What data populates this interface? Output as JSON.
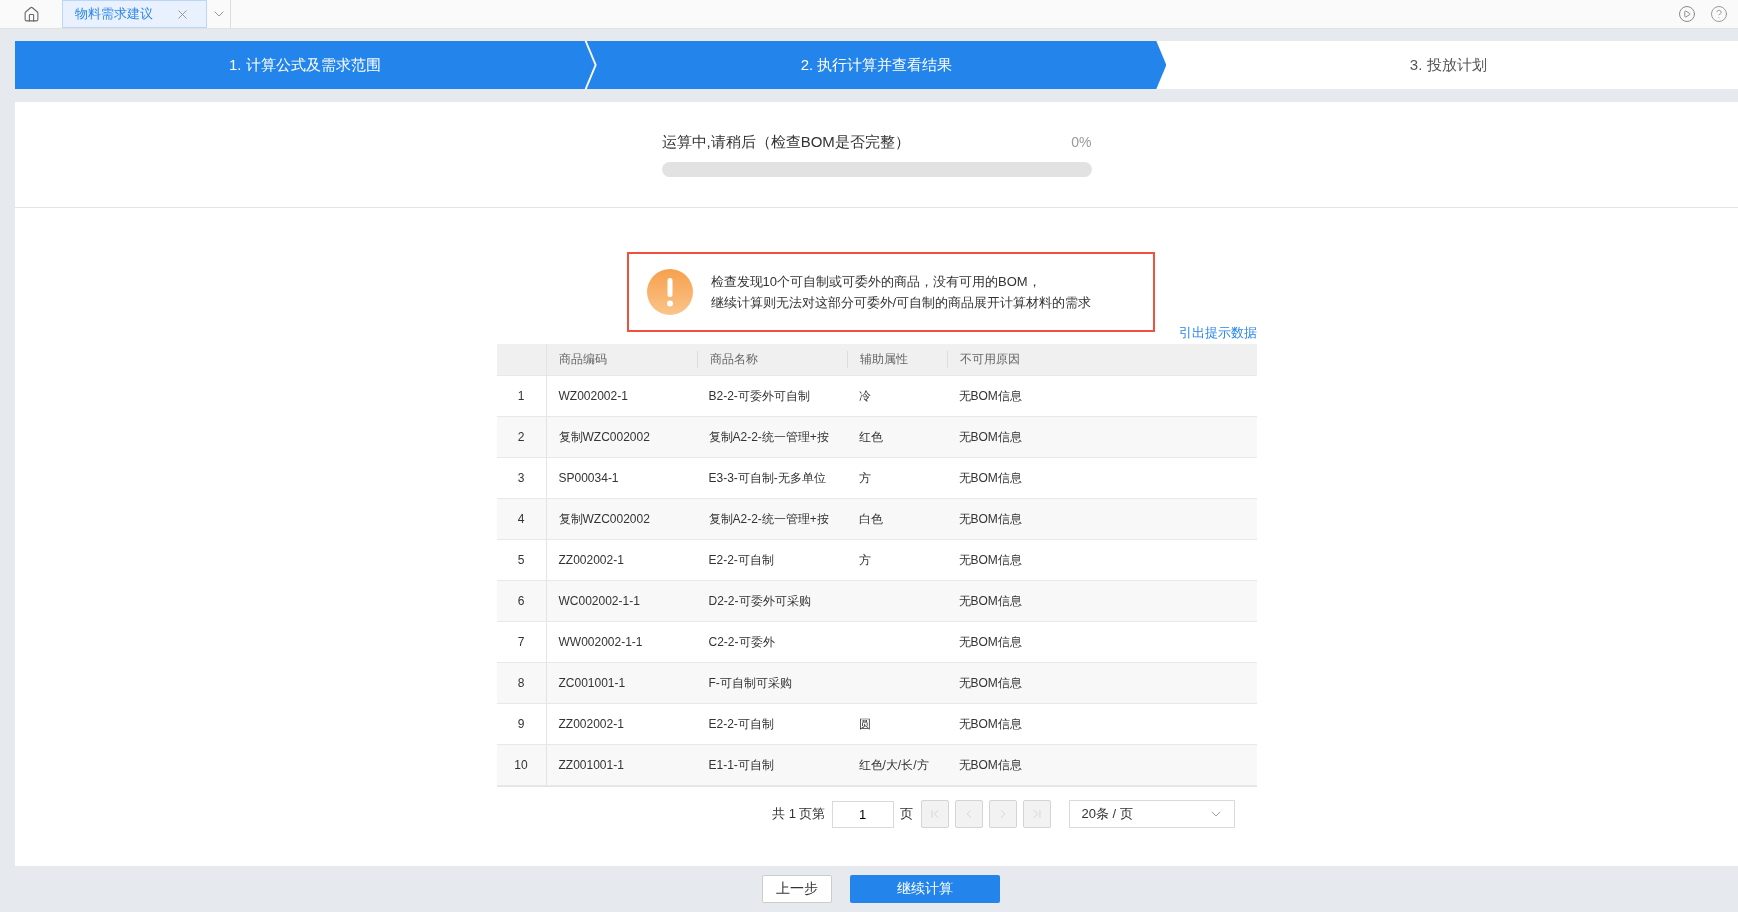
{
  "tab_bar": {
    "tab": {
      "label": "物料需求建议",
      "selected": true
    }
  },
  "steps": [
    {
      "label": "1. 计算公式及需求范围",
      "active": true
    },
    {
      "label": "2. 执行计算并查看结果",
      "active": true
    },
    {
      "label": "3. 投放计划",
      "active": false
    }
  ],
  "progress": {
    "message": "运算中,请稍后（检查BOM是否完整）",
    "percent": "0%",
    "level": 0
  },
  "warning": {
    "lines": [
      "检查发现10个可自制或可委外的商品，没有可用的BOM，",
      "继续计算则无法对这部分可委外/可自制的商品展开计算材料的需求"
    ]
  },
  "export_link": "引出提示数据",
  "table": {
    "columns": [
      "商品编码",
      "商品名称",
      "辅助属性",
      "不可用原因"
    ],
    "rows": [
      {
        "index": "1",
        "code": "WZ002002-1",
        "name": "B2-2-可委外可自制",
        "attribute": "冷",
        "reason": "无BOM信息"
      },
      {
        "index": "2",
        "code": "复制WZC002002",
        "name": "复制A2-2-统一管理+按",
        "attribute": "红色",
        "reason": "无BOM信息"
      },
      {
        "index": "3",
        "code": "SP00034-1",
        "name": "E3-3-可自制-无多单位",
        "attribute": "方",
        "reason": "无BOM信息"
      },
      {
        "index": "4",
        "code": "复制WZC002002",
        "name": "复制A2-2-统一管理+按",
        "attribute": "白色",
        "reason": "无BOM信息"
      },
      {
        "index": "5",
        "code": "ZZ002002-1",
        "name": "E2-2-可自制",
        "attribute": "方",
        "reason": "无BOM信息"
      },
      {
        "index": "6",
        "code": "WC002002-1-1",
        "name": "D2-2-可委外可采购",
        "reason": "无BOM信息"
      },
      {
        "index": "7",
        "code": "WW002002-1-1",
        "name": "C2-2-可委外",
        "reason": "无BOM信息"
      },
      {
        "index": "8",
        "code": "ZC001001-1",
        "name": "F-可自制可采购",
        "reason": "无BOM信息"
      },
      {
        "index": "9",
        "code": "ZZ002002-1",
        "name": "E2-2-可自制",
        "attribute": "圆",
        "reason": "无BOM信息"
      },
      {
        "index": "10",
        "code": "ZZ001001-1",
        "name": "E1-1-可自制",
        "attribute": "红色/大/长/方",
        "reason": "无BOM信息"
      }
    ]
  },
  "pagination": {
    "prefix": "共 1 页第",
    "page": "1",
    "suffix": "页",
    "page_size": "20条 / 页",
    "nav": [
      {
        "kind": "first",
        "disabled": true
      },
      {
        "kind": "prev",
        "disabled": true
      },
      {
        "kind": "next",
        "disabled": true
      },
      {
        "kind": "last",
        "disabled": true
      }
    ]
  },
  "buttons": [
    {
      "label": "上一步",
      "kind": "secondary"
    },
    {
      "label": "继续计算",
      "kind": "primary"
    }
  ]
}
